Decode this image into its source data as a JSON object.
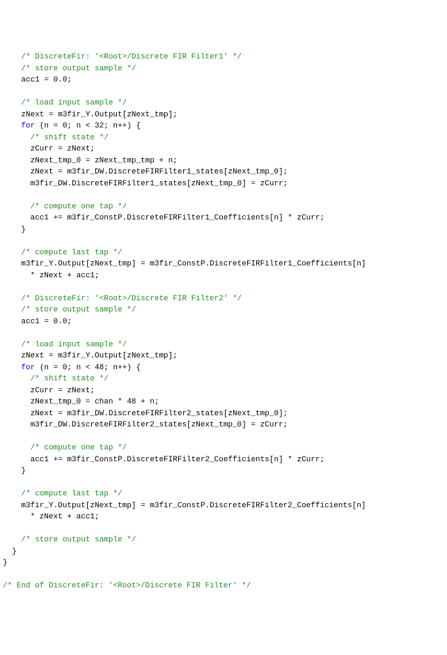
{
  "code_lines": [
    {
      "indent": "    ",
      "parts": [
        {
          "cls": "comment",
          "text": "/* DiscreteFir: '<Root>/Discrete FIR Filter1' */"
        }
      ]
    },
    {
      "indent": "    ",
      "parts": [
        {
          "cls": "comment",
          "text": "/* store output sample */"
        }
      ]
    },
    {
      "indent": "    ",
      "parts": [
        {
          "cls": "text",
          "text": "acc1 = 0.0;"
        }
      ]
    },
    {
      "indent": "",
      "parts": [
        {
          "cls": "text",
          "text": ""
        }
      ]
    },
    {
      "indent": "    ",
      "parts": [
        {
          "cls": "comment",
          "text": "/* load input sample */"
        }
      ]
    },
    {
      "indent": "    ",
      "parts": [
        {
          "cls": "text",
          "text": "zNext = m3fir_Y.Output[zNext_tmp];"
        }
      ]
    },
    {
      "indent": "    ",
      "parts": [
        {
          "cls": "keyword",
          "text": "for"
        },
        {
          "cls": "text",
          "text": " (n = 0; n < 32; n++) {"
        }
      ]
    },
    {
      "indent": "      ",
      "parts": [
        {
          "cls": "comment",
          "text": "/* shift state */"
        }
      ]
    },
    {
      "indent": "      ",
      "parts": [
        {
          "cls": "text",
          "text": "zCurr = zNext;"
        }
      ]
    },
    {
      "indent": "      ",
      "parts": [
        {
          "cls": "text",
          "text": "zNext_tmp_0 = zNext_tmp_tmp + n;"
        }
      ]
    },
    {
      "indent": "      ",
      "parts": [
        {
          "cls": "text",
          "text": "zNext = m3fir_DW.DiscreteFIRFilter1_states[zNext_tmp_0];"
        }
      ]
    },
    {
      "indent": "      ",
      "parts": [
        {
          "cls": "text",
          "text": "m3fir_DW.DiscreteFIRFilter1_states[zNext_tmp_0] = zCurr;"
        }
      ]
    },
    {
      "indent": "",
      "parts": [
        {
          "cls": "text",
          "text": ""
        }
      ]
    },
    {
      "indent": "      ",
      "parts": [
        {
          "cls": "comment",
          "text": "/* compute one tap */"
        }
      ]
    },
    {
      "indent": "      ",
      "parts": [
        {
          "cls": "text",
          "text": "acc1 += m3fir_ConstP.DiscreteFIRFilter1_Coefficients[n] * zCurr;"
        }
      ]
    },
    {
      "indent": "    ",
      "parts": [
        {
          "cls": "text",
          "text": "}"
        }
      ]
    },
    {
      "indent": "",
      "parts": [
        {
          "cls": "text",
          "text": ""
        }
      ]
    },
    {
      "indent": "    ",
      "parts": [
        {
          "cls": "comment",
          "text": "/* compute last tap */"
        }
      ]
    },
    {
      "indent": "    ",
      "parts": [
        {
          "cls": "text",
          "text": "m3fir_Y.Output[zNext_tmp] = m3fir_ConstP.DiscreteFIRFilter1_Coefficients[n]"
        }
      ]
    },
    {
      "indent": "      ",
      "parts": [
        {
          "cls": "text",
          "text": "* zNext + acc1;"
        }
      ]
    },
    {
      "indent": "",
      "parts": [
        {
          "cls": "text",
          "text": ""
        }
      ]
    },
    {
      "indent": "    ",
      "parts": [
        {
          "cls": "comment",
          "text": "/* DiscreteFir: '<Root>/Discrete FIR Filter2' */"
        }
      ]
    },
    {
      "indent": "    ",
      "parts": [
        {
          "cls": "comment",
          "text": "/* store output sample */"
        }
      ]
    },
    {
      "indent": "    ",
      "parts": [
        {
          "cls": "text",
          "text": "acc1 = 0.0;"
        }
      ]
    },
    {
      "indent": "",
      "parts": [
        {
          "cls": "text",
          "text": ""
        }
      ]
    },
    {
      "indent": "    ",
      "parts": [
        {
          "cls": "comment",
          "text": "/* load input sample */"
        }
      ]
    },
    {
      "indent": "    ",
      "parts": [
        {
          "cls": "text",
          "text": "zNext = m3fir_Y.Output[zNext_tmp];"
        }
      ]
    },
    {
      "indent": "    ",
      "parts": [
        {
          "cls": "keyword",
          "text": "for"
        },
        {
          "cls": "text",
          "text": " (n = 0; n < 48; n++) {"
        }
      ]
    },
    {
      "indent": "      ",
      "parts": [
        {
          "cls": "comment",
          "text": "/* shift state */"
        }
      ]
    },
    {
      "indent": "      ",
      "parts": [
        {
          "cls": "text",
          "text": "zCurr = zNext;"
        }
      ]
    },
    {
      "indent": "      ",
      "parts": [
        {
          "cls": "text",
          "text": "zNext_tmp_0 = chan * 48 + n;"
        }
      ]
    },
    {
      "indent": "      ",
      "parts": [
        {
          "cls": "text",
          "text": "zNext = m3fir_DW.DiscreteFIRFilter2_states[zNext_tmp_0];"
        }
      ]
    },
    {
      "indent": "      ",
      "parts": [
        {
          "cls": "text",
          "text": "m3fir_DW.DiscreteFIRFilter2_states[zNext_tmp_0] = zCurr;"
        }
      ]
    },
    {
      "indent": "",
      "parts": [
        {
          "cls": "text",
          "text": ""
        }
      ]
    },
    {
      "indent": "      ",
      "parts": [
        {
          "cls": "comment",
          "text": "/* compute one tap */"
        }
      ]
    },
    {
      "indent": "      ",
      "parts": [
        {
          "cls": "text",
          "text": "acc1 += m3fir_ConstP.DiscreteFIRFilter2_Coefficients[n] * zCurr;"
        }
      ]
    },
    {
      "indent": "    ",
      "parts": [
        {
          "cls": "text",
          "text": "}"
        }
      ]
    },
    {
      "indent": "",
      "parts": [
        {
          "cls": "text",
          "text": ""
        }
      ]
    },
    {
      "indent": "    ",
      "parts": [
        {
          "cls": "comment",
          "text": "/* compute last tap */"
        }
      ]
    },
    {
      "indent": "    ",
      "parts": [
        {
          "cls": "text",
          "text": "m3fir_Y.Output[zNext_tmp] = m3fir_ConstP.DiscreteFIRFilter2_Coefficients[n]"
        }
      ]
    },
    {
      "indent": "      ",
      "parts": [
        {
          "cls": "text",
          "text": "* zNext + acc1;"
        }
      ]
    },
    {
      "indent": "",
      "parts": [
        {
          "cls": "text",
          "text": ""
        }
      ]
    },
    {
      "indent": "    ",
      "parts": [
        {
          "cls": "comment",
          "text": "/* store output sample */"
        }
      ]
    },
    {
      "indent": "  ",
      "parts": [
        {
          "cls": "text",
          "text": "}"
        }
      ]
    },
    {
      "indent": "",
      "parts": [
        {
          "cls": "text",
          "text": "}"
        }
      ]
    },
    {
      "indent": "",
      "parts": [
        {
          "cls": "text",
          "text": ""
        }
      ]
    },
    {
      "indent": "",
      "parts": [
        {
          "cls": "comment",
          "text": "/* End of DiscreteFir: '<Root>/Discrete FIR Filter' */"
        }
      ]
    }
  ]
}
